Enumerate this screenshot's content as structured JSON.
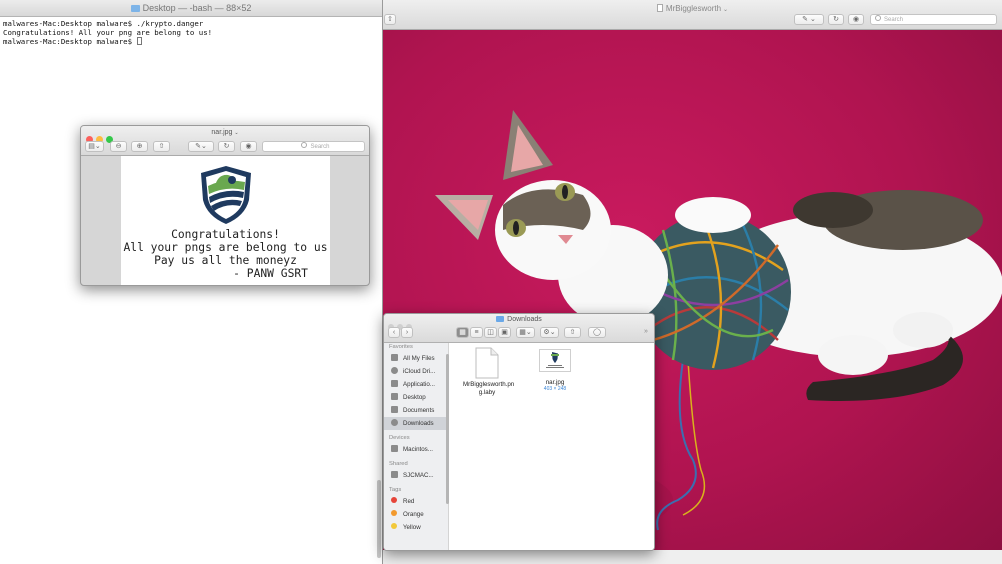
{
  "terminal": {
    "title": "Desktop — -bash — 88×52",
    "lines": [
      "malwares-Mac:Desktop malware$ ./krypto.danger",
      "Congratulations! All your png are belong to us!",
      "malwares-Mac:Desktop malware$ "
    ]
  },
  "preview_main": {
    "title": "MrBigglesworth",
    "search_placeholder": "Search"
  },
  "preview_small": {
    "title": "nar.jpg",
    "search_placeholder": "Search",
    "ransom_lines": [
      "Congratulations!",
      "All your pngs are belong to us",
      "Pay us all the moneyz",
      "- PANW GSRT"
    ]
  },
  "finder": {
    "title": "Downloads",
    "sections": {
      "favorites": "Favorites",
      "devices": "Devices",
      "shared": "Shared",
      "tags": "Tags"
    },
    "favorites": [
      "All My Files",
      "iCloud Dri...",
      "Applicatio...",
      "Desktop",
      "Documents",
      "Downloads"
    ],
    "devices": [
      "Macintos..."
    ],
    "shared": [
      "SJCMAC..."
    ],
    "tags": [
      {
        "label": "Red",
        "color": "#e6453a"
      },
      {
        "label": "Orange",
        "color": "#f29a2e"
      },
      {
        "label": "Yellow",
        "color": "#f2c93a"
      }
    ],
    "files": [
      {
        "name": "MrBigglesworth.pn g.laby",
        "sub": ""
      },
      {
        "name": "nar.jpg",
        "sub": "403 × 248"
      }
    ]
  },
  "colors": {
    "close": "#fc605c",
    "minimize": "#fdbc40",
    "zoom": "#34c84a",
    "shield_green": "#6aa84f",
    "shield_navy": "#1f3a5f"
  }
}
